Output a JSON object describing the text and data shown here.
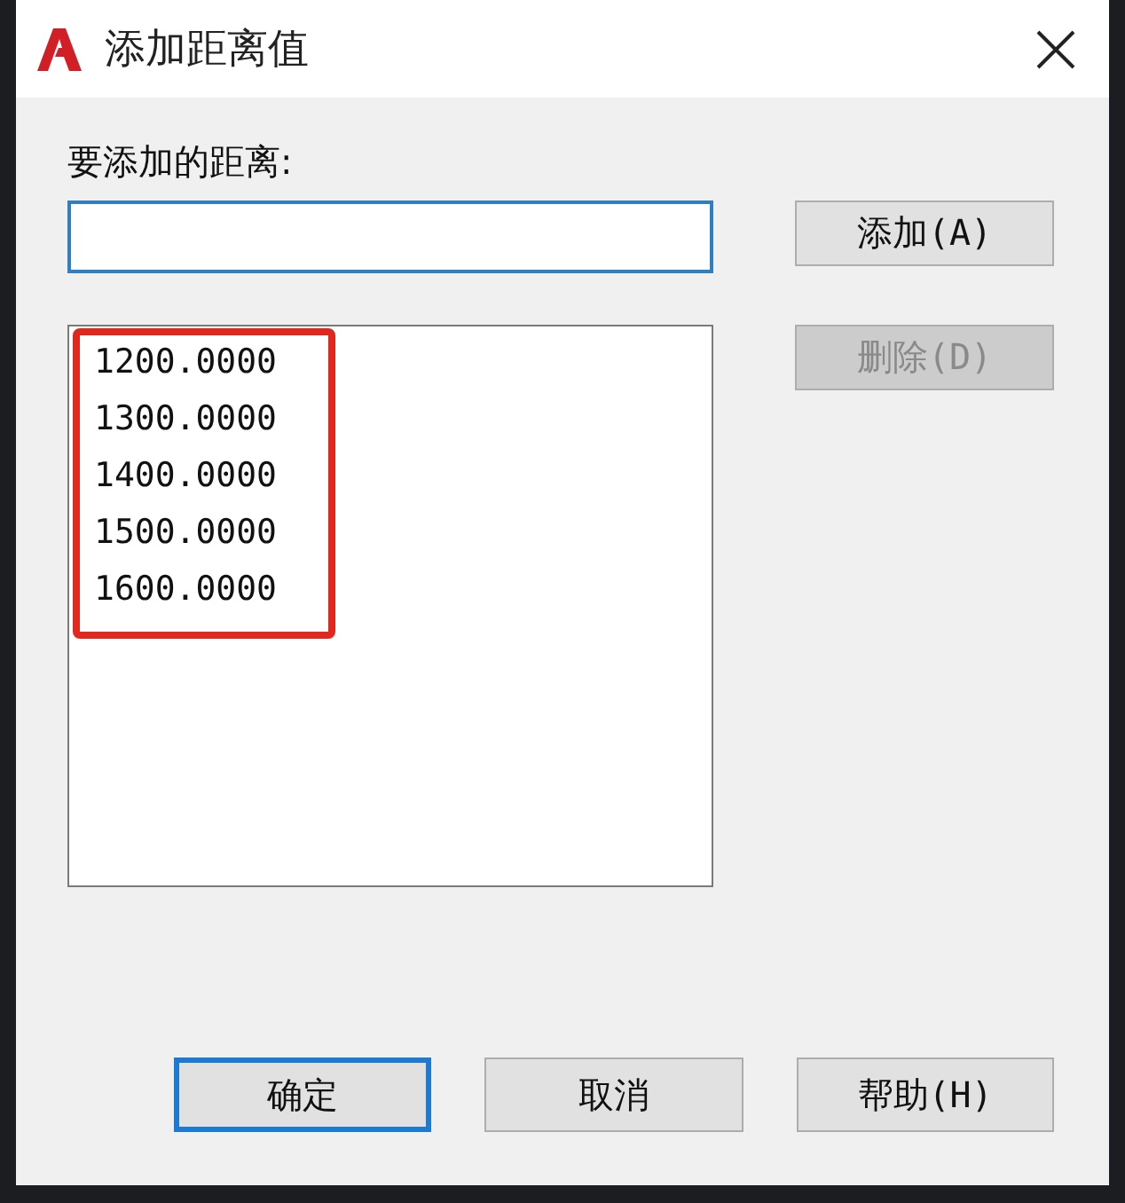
{
  "window": {
    "title": "添加距离值"
  },
  "field": {
    "label": "要添加的距离:"
  },
  "list": {
    "items": [
      "1200.0000",
      "1300.0000",
      "1400.0000",
      "1500.0000",
      "1600.0000"
    ]
  },
  "side_buttons": [
    {
      "label": "添加(A)",
      "disabled": false
    },
    {
      "label": "删除(D)",
      "disabled": true
    }
  ],
  "buttons": [
    {
      "label": "确定",
      "default": true
    },
    {
      "label": "取消",
      "default": false
    },
    {
      "label": "帮助(H)",
      "default": false
    }
  ]
}
